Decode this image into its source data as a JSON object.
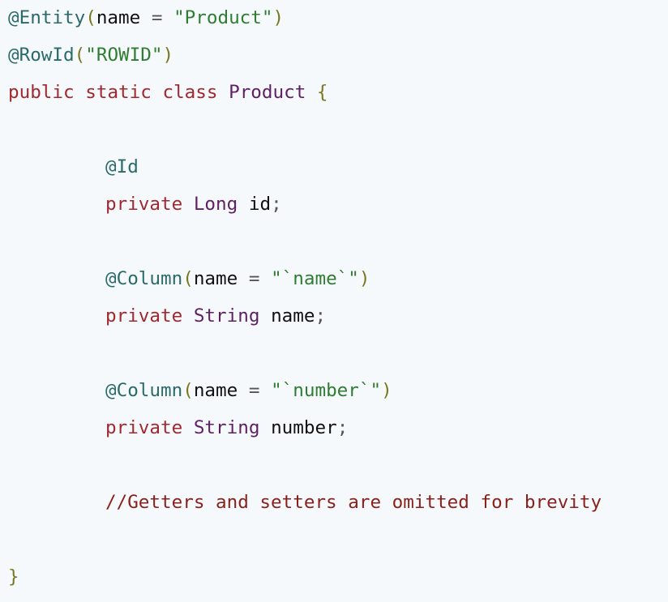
{
  "code": {
    "line1": {
      "annotation": "@Entity",
      "open_paren": "(",
      "attr": "name",
      "equals": " = ",
      "value": "\"Product\"",
      "close_paren": ")"
    },
    "line2": {
      "annotation": "@RowId",
      "open_paren": "(",
      "value": "\"ROWID\"",
      "close_paren": ")"
    },
    "line3": {
      "kw_public": "public",
      "kw_static": "static",
      "kw_class": "class",
      "class_name": "Product",
      "open_brace": "{"
    },
    "line5": {
      "annotation": "@Id"
    },
    "line6": {
      "kw_private": "private",
      "type": "Long",
      "name": "id",
      "semicolon": ";"
    },
    "line8": {
      "annotation": "@Column",
      "open_paren": "(",
      "attr": "name",
      "equals": " = ",
      "value": "\"`name`\"",
      "close_paren": ")"
    },
    "line9": {
      "kw_private": "private",
      "type": "String",
      "name": "name",
      "semicolon": ";"
    },
    "line11": {
      "annotation": "@Column",
      "open_paren": "(",
      "attr": "name",
      "equals": " = ",
      "value": "\"`number`\"",
      "close_paren": ")"
    },
    "line12": {
      "kw_private": "private",
      "type": "String",
      "name": "number",
      "semicolon": ";"
    },
    "line14": {
      "comment": "//Getters and setters are omitted for brevity"
    },
    "line16": {
      "close_brace": "}"
    }
  },
  "colors": {
    "background": "#f6f9fc",
    "annotation": "#2a6a6a",
    "keyword": "#a0282e",
    "type": "#5e1f63",
    "string": "#2e7d32",
    "comment": "#8b1f1a",
    "brace": "#787820"
  }
}
